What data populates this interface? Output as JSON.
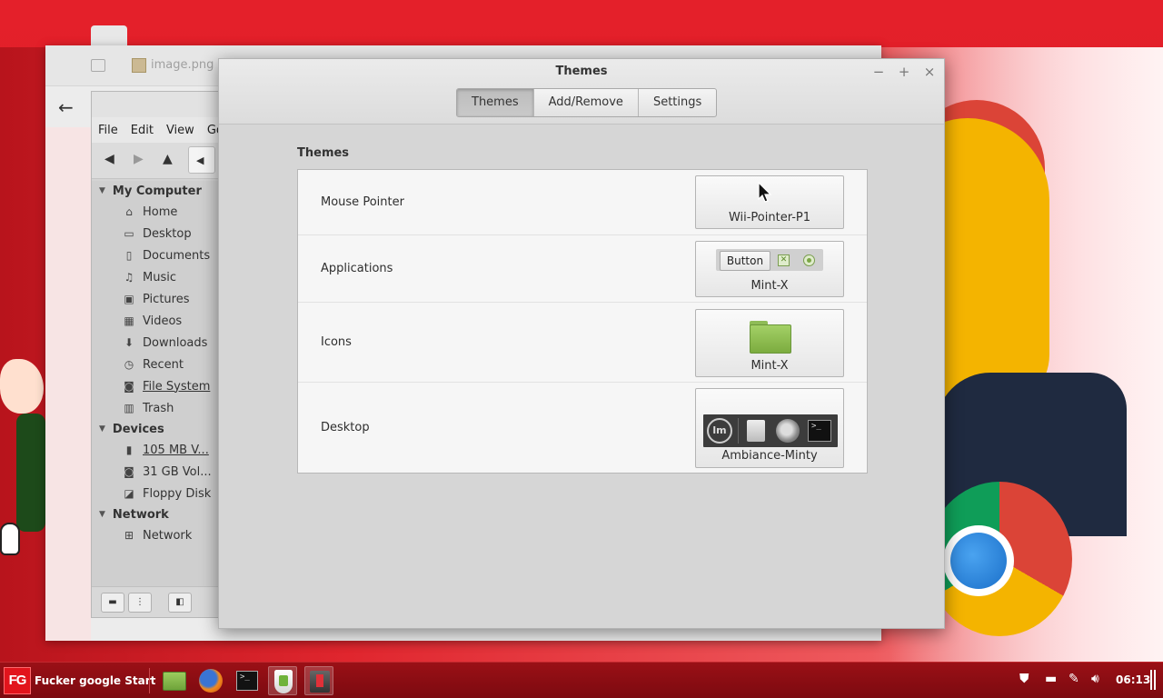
{
  "background_window": {
    "tab_title": "image.png (",
    "menu": [
      "File",
      "Edit",
      "View",
      "Go"
    ],
    "sidebar": {
      "sections": [
        {
          "label": "My Computer",
          "items": [
            {
              "label": "Home",
              "icon": "home-icon"
            },
            {
              "label": "Desktop",
              "icon": "desktop-icon"
            },
            {
              "label": "Documents",
              "icon": "documents-icon"
            },
            {
              "label": "Music",
              "icon": "music-icon"
            },
            {
              "label": "Pictures",
              "icon": "pictures-icon"
            },
            {
              "label": "Videos",
              "icon": "videos-icon"
            },
            {
              "label": "Downloads",
              "icon": "downloads-icon"
            },
            {
              "label": "Recent",
              "icon": "recent-icon"
            },
            {
              "label": "File System",
              "icon": "drive-icon"
            },
            {
              "label": "Trash",
              "icon": "trash-icon"
            }
          ]
        },
        {
          "label": "Devices",
          "items": [
            {
              "label": "105 MB V...",
              "icon": "usb-icon"
            },
            {
              "label": "31 GB Vol...",
              "icon": "drive-icon"
            },
            {
              "label": "Floppy Disk",
              "icon": "floppy-icon"
            }
          ]
        },
        {
          "label": "Network",
          "items": [
            {
              "label": "Network",
              "icon": "network-icon"
            }
          ]
        }
      ]
    }
  },
  "themes_window": {
    "title": "Themes",
    "controls": {
      "minimize": "−",
      "maximize": "+",
      "close": "×"
    },
    "tabs": [
      {
        "label": "Themes",
        "active": true
      },
      {
        "label": "Add/Remove",
        "active": false
      },
      {
        "label": "Settings",
        "active": false
      }
    ],
    "section_title": "Themes",
    "rows": [
      {
        "label": "Mouse Pointer",
        "value": "Wii-Pointer-P1"
      },
      {
        "label": "Applications",
        "value": "Mint-X",
        "preview_button": "Button"
      },
      {
        "label": "Icons",
        "value": "Mint-X"
      },
      {
        "label": "Desktop",
        "value": "Ambiance-Minty"
      }
    ]
  },
  "taskbar": {
    "start_logo": "FG",
    "start_label": "Fucker google Start",
    "launchers": [
      "file-manager-icon",
      "firefox-icon",
      "terminal-icon",
      "update-manager-icon",
      "mintmenu-icon"
    ],
    "tray_icons": [
      "shield-icon",
      "keyboard-icon",
      "pen-icon",
      "volume-icon"
    ],
    "clock": "06:13"
  },
  "colors": {
    "accent_red": "#e01c24",
    "taskbar": "#8a0e14",
    "window_bg": "#d6d6d6",
    "active_tab": "#c3c3c3"
  }
}
